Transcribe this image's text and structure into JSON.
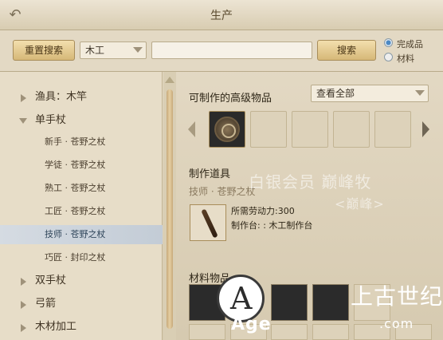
{
  "window": {
    "title": "生产"
  },
  "toolbar": {
    "reset_label": "重置搜索",
    "category_value": "木工",
    "search_value": "",
    "search_label": "搜索",
    "radio_finished": "完成品",
    "radio_material": "材料",
    "radio_selected": "完成品"
  },
  "tree": {
    "items": [
      {
        "label": "渔具：木竿",
        "expanded": false
      },
      {
        "label": "单手杖",
        "expanded": true
      },
      {
        "label": "双手杖",
        "expanded": false
      },
      {
        "label": "弓箭",
        "expanded": false
      },
      {
        "label": "木材加工",
        "expanded": false
      }
    ],
    "subitems": [
      {
        "label": "新手 · 苍野之杖"
      },
      {
        "label": "学徒 · 苍野之杖"
      },
      {
        "label": "熟工 · 苍野之杖"
      },
      {
        "label": "工匠 · 苍野之杖"
      },
      {
        "label": "技师 · 苍野之杖",
        "selected": true
      },
      {
        "label": "巧匠 · 封印之杖"
      }
    ]
  },
  "right": {
    "advanced_heading": "可制作的高级物品",
    "view_select": "查看全部",
    "tool_heading": "制作道具",
    "tool_name": "技师 · 苍野之杖",
    "labor": "所需劳动力:300",
    "workbench": "制作台: : 木工制作台",
    "materials_heading": "材料物品"
  },
  "overlay": {
    "vip_text": "白银会员 巅峰牧",
    "vip_sub": "<巅峰>",
    "site_text": "Age",
    "site_suffix": ".com",
    "site_cn": "上古世纪"
  },
  "icons": {
    "back": "back-arrow-icon",
    "caret": "chevron-down-icon",
    "nav_left": "chevron-left-icon",
    "nav_right": "chevron-right-icon"
  },
  "colors": {
    "accent_button": "#d6b878",
    "selection": "#c3ccd6",
    "radio_on": "#4c89c4"
  }
}
